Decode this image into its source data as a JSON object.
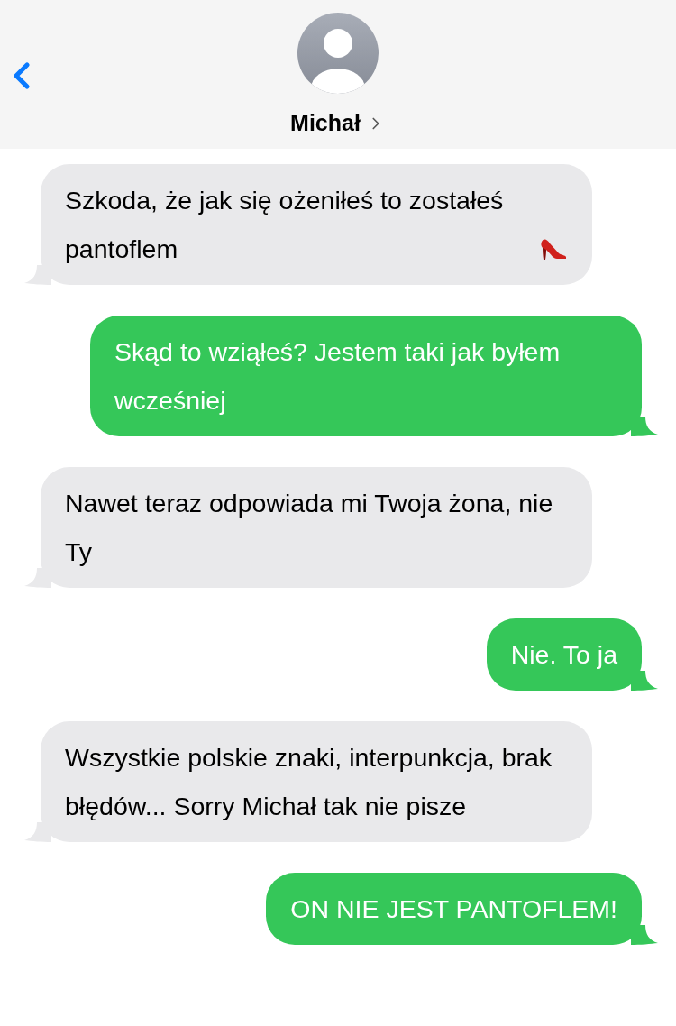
{
  "header": {
    "contact_name": "Michał"
  },
  "messages": [
    {
      "kind": "incoming",
      "text": "Szkoda, że jak się ożeniłeś to zostałeś pantoflem",
      "trailing_icon": true
    },
    {
      "kind": "outgoing",
      "text": "Skąd to wziąłeś? Jestem taki jak byłem wcześniej",
      "trailing_icon": false
    },
    {
      "kind": "incoming",
      "text": "Nawet teraz odpowiada mi Twoja żona, nie Ty",
      "trailing_icon": false
    },
    {
      "kind": "outgoing",
      "text": "Nie. To ja",
      "trailing_icon": false
    },
    {
      "kind": "incoming",
      "text": "Wszystkie polskie znaki, interpunkcja, brak błędów... Sorry Michał tak nie pisze",
      "trailing_icon": false
    },
    {
      "kind": "outgoing",
      "text": "ON NIE JEST PANTOFLEM!",
      "trailing_icon": false
    }
  ]
}
